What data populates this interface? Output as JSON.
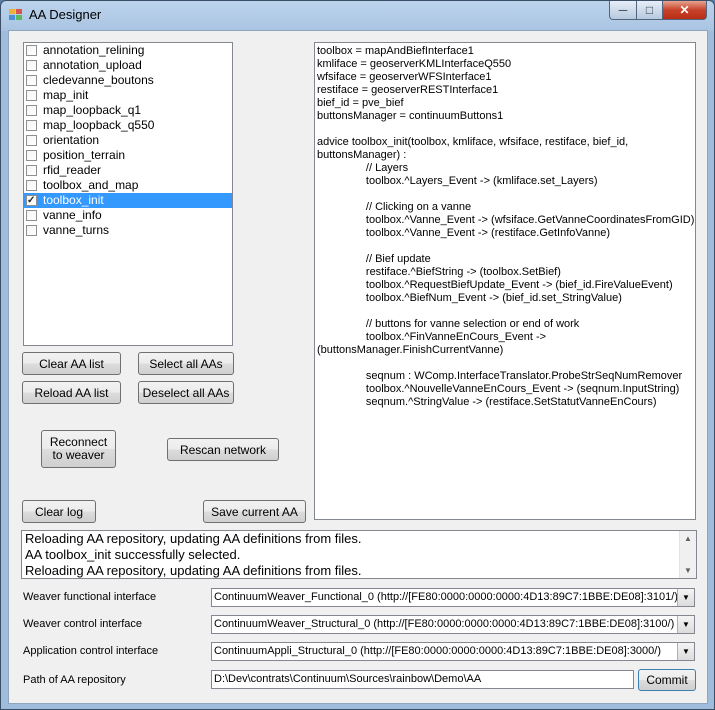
{
  "window": {
    "title": "AA Designer"
  },
  "aa_list": [
    {
      "label": "annotation_relining",
      "checked": false,
      "selected": false
    },
    {
      "label": "annotation_upload",
      "checked": false,
      "selected": false
    },
    {
      "label": "cledevanne_boutons",
      "checked": false,
      "selected": false
    },
    {
      "label": "map_init",
      "checked": false,
      "selected": false
    },
    {
      "label": "map_loopback_q1",
      "checked": false,
      "selected": false
    },
    {
      "label": "map_loopback_q550",
      "checked": false,
      "selected": false
    },
    {
      "label": "orientation",
      "checked": false,
      "selected": false
    },
    {
      "label": "position_terrain",
      "checked": false,
      "selected": false
    },
    {
      "label": "rfid_reader",
      "checked": false,
      "selected": false
    },
    {
      "label": "toolbox_and_map",
      "checked": false,
      "selected": false
    },
    {
      "label": "toolbox_init",
      "checked": true,
      "selected": true
    },
    {
      "label": "vanne_info",
      "checked": false,
      "selected": false
    },
    {
      "label": "vanne_turns",
      "checked": false,
      "selected": false
    }
  ],
  "buttons": {
    "clear_aa_list": "Clear AA list",
    "select_all": "Select all AAs",
    "reload_aa_list": "Reload AA list",
    "deselect_all": "Deselect all AAs",
    "reconnect": "Reconnect to weaver",
    "rescan": "Rescan network",
    "clear_log": "Clear log",
    "save_current": "Save current AA",
    "commit": "Commit"
  },
  "code": "toolbox = mapAndBiefInterface1\nkmliface = geoserverKMLInterfaceQ550\nwfsiface = geoserverWFSInterface1\nrestiface = geoserverRESTInterface1\nbief_id = pve_bief\nbuttonsManager = continuumButtons1\n\nadvice toolbox_init(toolbox, kmliface, wfsiface, restiface, bief_id, buttonsManager) :\n                // Layers\n                toolbox.^Layers_Event -> (kmliface.set_Layers)\n\n                // Clicking on a vanne\n                toolbox.^Vanne_Event -> (wfsiface.GetVanneCoordinatesFromGID)\n                toolbox.^Vanne_Event -> (restiface.GetInfoVanne)\n\n                // Bief update\n                restiface.^BiefString -> (toolbox.SetBief)\n                toolbox.^RequestBiefUpdate_Event -> (bief_id.FireValueEvent)\n                toolbox.^BiefNum_Event -> (bief_id.set_StringValue)\n\n                // buttons for vanne selection or end of work\n                toolbox.^FinVanneEnCours_Event ->\n(buttonsManager.FinishCurrentVanne)\n\n                seqnum : WComp.InterfaceTranslator.ProbeStrSeqNumRemover\n                toolbox.^NouvelleVanneEnCours_Event -> (seqnum.InputString)\n                seqnum.^StringValue -> (restiface.SetStatutVanneEnCours)",
  "log": [
    "Reloading AA repository, updating AA definitions from files.",
    "AA toolbox_init successfully selected.",
    "Reloading AA repository, updating AA definitions from files."
  ],
  "fields": {
    "weaver_functional_label": "Weaver functional interface",
    "weaver_functional_value": "ContinuumWeaver_Functional_0 (http://[FE80:0000:0000:0000:4D13:89C7:1BBE:DE08]:3101/)",
    "weaver_control_label": "Weaver control interface",
    "weaver_control_value": "ContinuumWeaver_Structural_0 (http://[FE80:0000:0000:0000:4D13:89C7:1BBE:DE08]:3100/)",
    "app_control_label": "Application control interface",
    "app_control_value": "ContinuumAppli_Structural_0 (http://[FE80:0000:0000:0000:4D13:89C7:1BBE:DE08]:3000/)",
    "repo_path_label": "Path of AA repository",
    "repo_path_value": "D:\\Dev\\contrats\\Continuum\\Sources\\rainbow\\Demo\\AA"
  }
}
